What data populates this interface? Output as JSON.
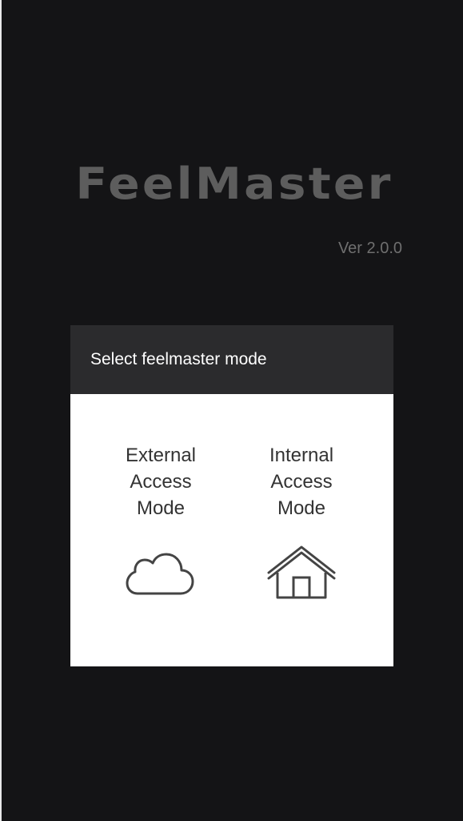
{
  "app": {
    "logo_text": "FeelMaster",
    "version": "Ver 2.0.0"
  },
  "dialog": {
    "title": "Select feelmaster mode",
    "options": [
      {
        "line1": "External",
        "line2": "Access",
        "line3": "Mode",
        "icon": "cloud-icon"
      },
      {
        "line1": "Internal",
        "line2": "Access",
        "line3": "Mode",
        "icon": "home-icon"
      }
    ]
  },
  "colors": {
    "background": "#141416",
    "logo": "#5d5d5d",
    "dialog_header": "#2b2b2d",
    "dialog_body": "#ffffff",
    "option_text": "#333333",
    "icon_stroke": "#444444"
  }
}
